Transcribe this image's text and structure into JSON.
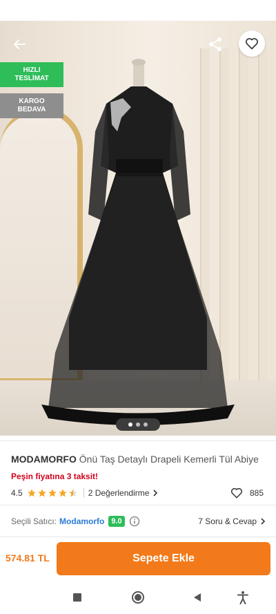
{
  "badges": {
    "fast_line1": "HIZLI",
    "fast_line2": "TESLİMAT",
    "cargo_line1": "KARGO",
    "cargo_line2": "BEDAVA"
  },
  "carousel": {
    "dot_count": 3,
    "active_index": 0
  },
  "product": {
    "brand": "MODAMORFO",
    "name": "Önü Taş Detaylı Drapeli Kemerli Tül Abiye",
    "installment_text": "Peşin fiyatına 3 taksit!",
    "rating": "4.5",
    "review_text": "2 Değerlendirme",
    "favorite_count": "885"
  },
  "seller": {
    "label": "Seçili Satıcı:",
    "name": "Modamorfo",
    "score": "9.0",
    "qa_text": "7 Soru & Cevap"
  },
  "bottom": {
    "price": "574.81 TL",
    "cart_label": "Sepete Ekle"
  },
  "icons": [
    "back-arrow-icon",
    "share-icon",
    "heart-icon",
    "star-icon",
    "chevron-right-icon",
    "info-icon",
    "recents-icon",
    "home-icon",
    "back-nav-icon",
    "accessibility-icon"
  ],
  "colors": {
    "accent": "#f27a1a",
    "green": "#2ebd59",
    "red": "#d0021b",
    "link": "#2b7bd6",
    "star": "#f5a623"
  }
}
